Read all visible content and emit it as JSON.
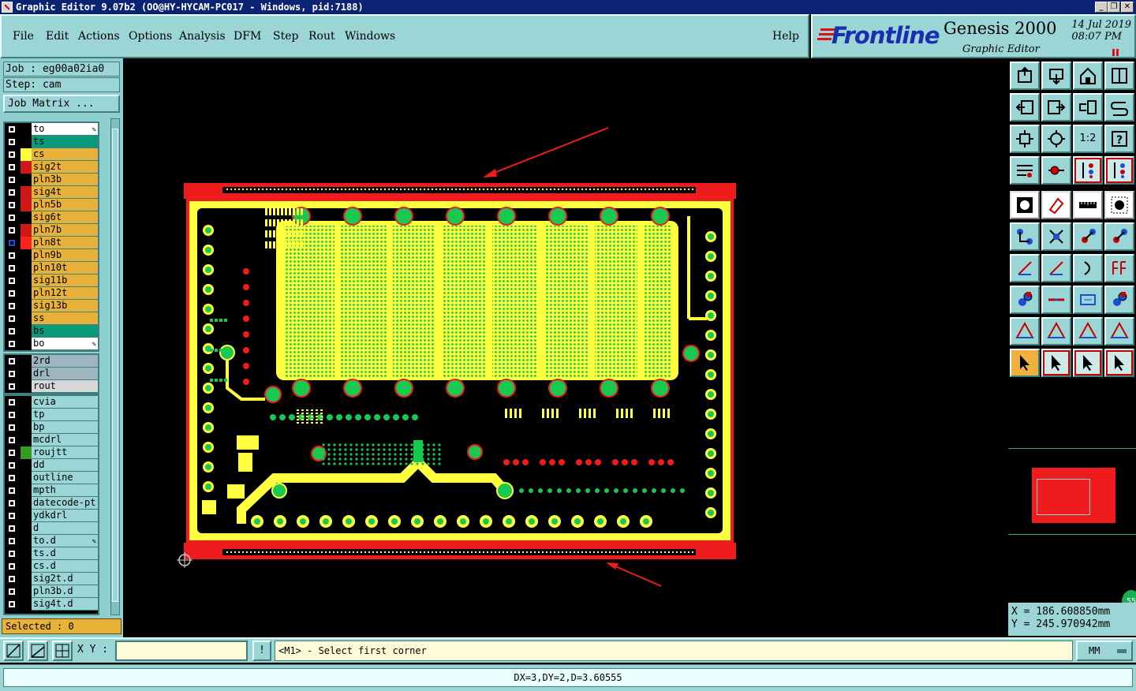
{
  "window": {
    "title": "Graphic Editor 9.07b2 (OO@HY-HYCAM-PC017 - Windows, pid:7188)",
    "buttons": [
      "_",
      "❐",
      "✕"
    ]
  },
  "menubar": {
    "items": [
      "File",
      "Edit",
      "Actions",
      "Options",
      "Analysis",
      "DFM",
      "Step",
      "Rout",
      "Windows"
    ],
    "help": "Help"
  },
  "branding": {
    "logo": "Frontline",
    "product": "Genesis 2000",
    "subtitle": "Graphic Editor",
    "date": "14 Jul 2019",
    "time": "08:07 PM"
  },
  "job": {
    "job_label": "Job : eg00a02ia0",
    "step_label": "Step: cam",
    "matrix_button": "Job Matrix ..."
  },
  "layers": {
    "board": [
      {
        "name": "to",
        "color": "#ffffff",
        "swatch": "",
        "edit": true
      },
      {
        "name": "ts",
        "color": "#0a9a7a",
        "swatch": ""
      },
      {
        "name": "cs",
        "color": "#e8b23a",
        "swatch": "#ffff40"
      },
      {
        "name": "sig2t",
        "color": "#e8b23a",
        "swatch": "#d01818"
      },
      {
        "name": "pln3b",
        "color": "#e8b23a",
        "swatch": ""
      },
      {
        "name": "sig4t",
        "color": "#e8b23a",
        "swatch": "#d01818"
      },
      {
        "name": "pln5b",
        "color": "#e8b23a",
        "swatch": "#d01818"
      },
      {
        "name": "sig6t",
        "color": "#e8b23a",
        "swatch": ""
      },
      {
        "name": "pln7b",
        "color": "#e8b23a",
        "swatch": "#d01818"
      },
      {
        "name": "pln8t",
        "color": "#e8b23a",
        "swatch": "#ff2020",
        "active": true
      },
      {
        "name": "pln9b",
        "color": "#e8b23a",
        "swatch": ""
      },
      {
        "name": "pln10t",
        "color": "#e8b23a",
        "swatch": ""
      },
      {
        "name": "sig11b",
        "color": "#e8b23a",
        "swatch": ""
      },
      {
        "name": "pln12t",
        "color": "#e8b23a",
        "swatch": ""
      },
      {
        "name": "sig13b",
        "color": "#e8b23a",
        "swatch": ""
      },
      {
        "name": "ss",
        "color": "#e8b23a",
        "swatch": ""
      },
      {
        "name": "bs",
        "color": "#0a9a7a",
        "swatch": ""
      },
      {
        "name": "bo",
        "color": "#ffffff",
        "swatch": "",
        "edit": true
      }
    ],
    "drill": [
      {
        "name": "2rd",
        "color": "#9fb5c0",
        "swatch": ""
      },
      {
        "name": "drl",
        "color": "#9fb5c0",
        "swatch": ""
      },
      {
        "name": "rout",
        "color": "#d8d8d8",
        "swatch": ""
      }
    ],
    "misc": [
      {
        "name": "cvia",
        "color": "#9bd5d5",
        "swatch": ""
      },
      {
        "name": "tp",
        "color": "#9bd5d5",
        "swatch": ""
      },
      {
        "name": "bp",
        "color": "#9bd5d5",
        "swatch": ""
      },
      {
        "name": "mcdrl",
        "color": "#9bd5d5",
        "swatch": ""
      },
      {
        "name": "roujtt",
        "color": "#9bd5d5",
        "swatch": "#3a9a20"
      },
      {
        "name": "dd",
        "color": "#9bd5d5",
        "swatch": ""
      },
      {
        "name": "outline",
        "color": "#9bd5d5",
        "swatch": ""
      },
      {
        "name": "mpth",
        "color": "#9bd5d5",
        "swatch": ""
      },
      {
        "name": "datecode-pt",
        "color": "#9bd5d5",
        "swatch": ""
      },
      {
        "name": "ydkdrl",
        "color": "#9bd5d5",
        "swatch": ""
      },
      {
        "name": "d",
        "color": "#9bd5d5",
        "swatch": ""
      },
      {
        "name": "to.d",
        "color": "#9bd5d5",
        "swatch": "",
        "edit": true
      },
      {
        "name": "ts.d",
        "color": "#9bd5d5",
        "swatch": ""
      },
      {
        "name": "cs.d",
        "color": "#9bd5d5",
        "swatch": ""
      },
      {
        "name": "sig2t.d",
        "color": "#9bd5d5",
        "swatch": ""
      },
      {
        "name": "pln3b.d",
        "color": "#9bd5d5",
        "swatch": ""
      },
      {
        "name": "sig4t.d",
        "color": "#9bd5d5",
        "swatch": ""
      }
    ]
  },
  "selected": "Selected : 0",
  "toolbar": {
    "ratio_label": "1:2",
    "help_label": "?"
  },
  "coords": {
    "x": "X  =  186.608850mm",
    "y": "Y  =  245.970942mm",
    "badge": "55"
  },
  "status": {
    "xy_label": "X Y :",
    "xy_value": "",
    "prompt_button": "!",
    "prompt": "<M1> - Select first corner",
    "units": "MM",
    "measurement": "DX=3,DY=2,D=3.60555"
  },
  "colors": {
    "panel": "#9bd5d5",
    "title": "#0a2473",
    "board_red": "#ee1c1c",
    "board_yellow": "#ffff40",
    "pad_green": "#18c850"
  }
}
